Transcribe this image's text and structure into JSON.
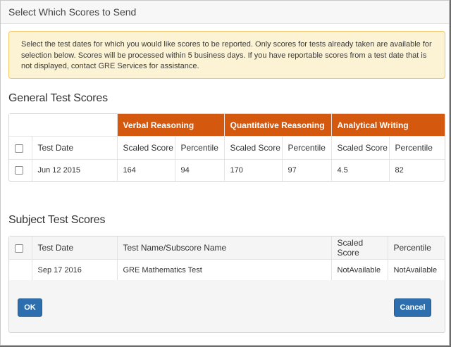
{
  "modal": {
    "title": "Select Which Scores to Send"
  },
  "notice": {
    "text": "Select the test dates for which you would like scores to be reported. Only scores for tests already taken are available for selection below. Scores will be processed within 5 business days. If you have reportable scores from a test date that is not displayed, contact GRE Services for assistance."
  },
  "general": {
    "title": "General Test Scores",
    "groups": [
      "Verbal Reasoning",
      "Quantitative Reasoning",
      "Analytical Writing"
    ],
    "headers": {
      "date": "Test Date",
      "scaled": "Scaled Score",
      "percentile": "Percentile"
    },
    "rows": [
      {
        "date": "Jun 12 2015",
        "v_scaled": "164",
        "v_pct": "94",
        "q_scaled": "170",
        "q_pct": "97",
        "a_scaled": "4.5",
        "a_pct": "82"
      }
    ]
  },
  "subject": {
    "title": "Subject Test Scores",
    "headers": {
      "date": "Test Date",
      "name": "Test Name/Subscore Name",
      "scaled": "Scaled Score",
      "percentile": "Percentile"
    },
    "rows": [
      {
        "date": "Sep 17 2016",
        "name": "GRE Mathematics Test",
        "scaled": "NotAvailable",
        "percentile": "NotAvailable"
      }
    ]
  },
  "buttons": {
    "ok": "OK",
    "cancel": "Cancel"
  },
  "colors": {
    "accent_orange": "#d4580e",
    "button_blue": "#2d6fae",
    "notice_bg": "#fcf3d4"
  }
}
